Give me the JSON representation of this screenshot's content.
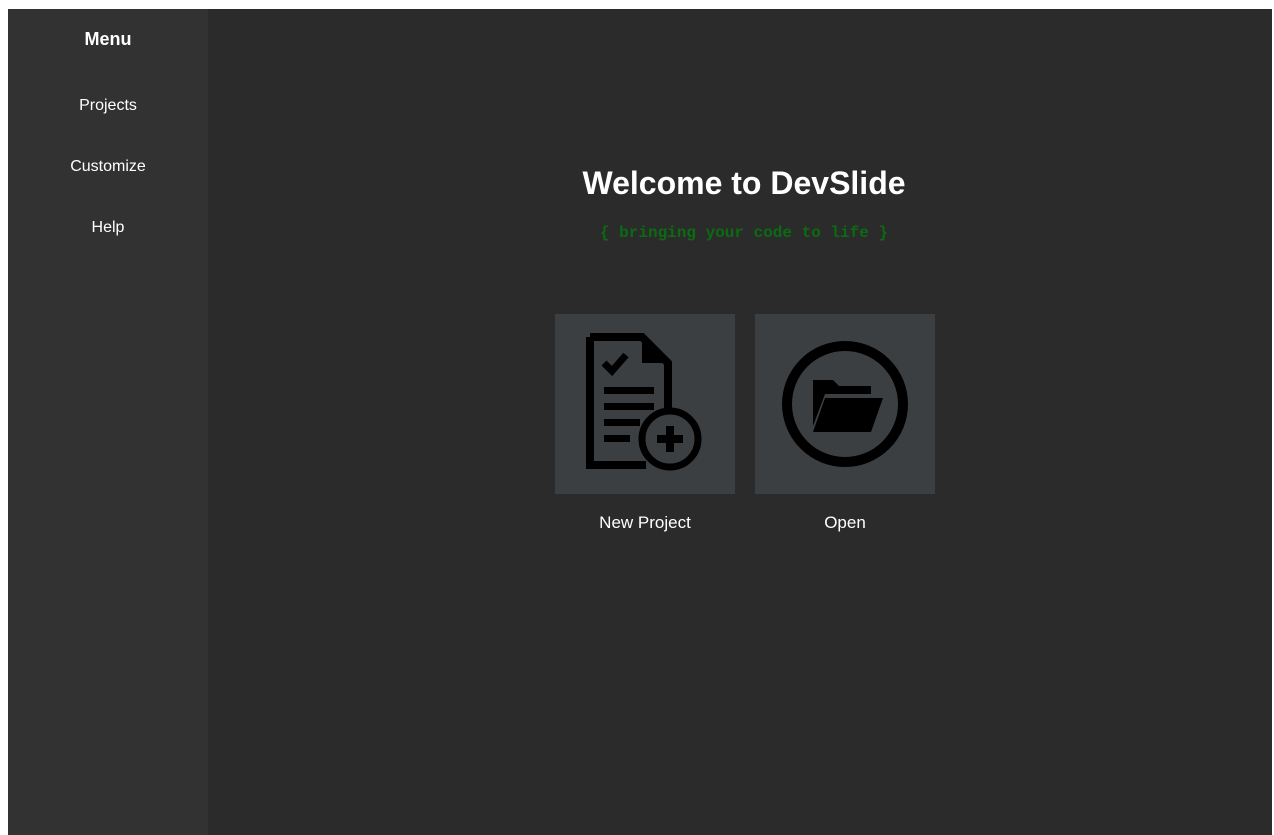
{
  "sidebar": {
    "title": "Menu",
    "items": [
      {
        "label": "Projects"
      },
      {
        "label": "Customize"
      },
      {
        "label": "Help"
      }
    ]
  },
  "main": {
    "title": "Welcome to DevSlide",
    "tagline": "{ bringing your code to life }",
    "actions": [
      {
        "label": "New Project",
        "icon": "new-document-icon"
      },
      {
        "label": "Open",
        "icon": "folder-open-icon"
      }
    ]
  },
  "colors": {
    "sidebar_bg": "#323232",
    "main_bg": "#2b2b2b",
    "tile_bg": "#3c3f41",
    "tagline": "#0b6b12"
  }
}
